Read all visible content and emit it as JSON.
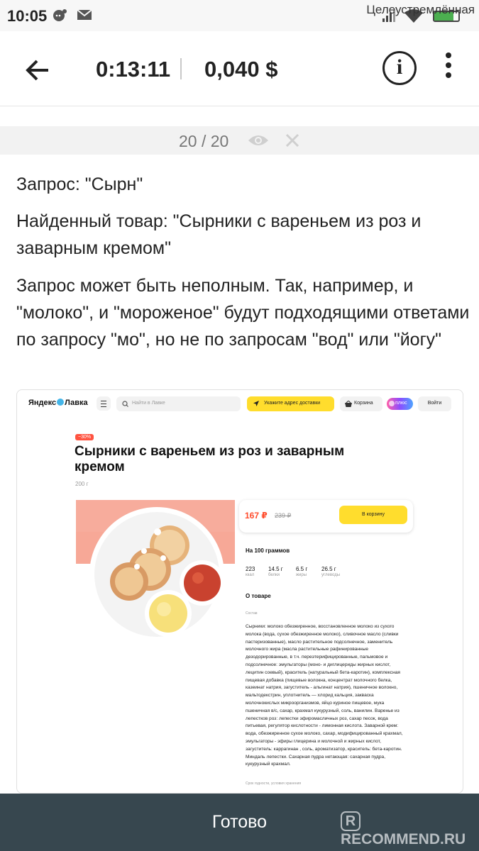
{
  "status_bar": {
    "time": "10:05",
    "carrier": "Целеустремлённая",
    "battery_level": 0.8
  },
  "header": {
    "timer": "0:13:11",
    "price": "0,040 $"
  },
  "strip": {
    "counter": "20 / 20"
  },
  "content": {
    "query": "Запрос: \"Сырн\"",
    "found": "Найденный товар: \"Сырники с вареньем из роз и заварным кремом\"",
    "note": "Запрос может быть неполным. Так, например, и \"молоко\", и \"мороженое\" будут подходящими ответами по запросу \"мо\", но не по запросам \"вод\" или \"йогу\""
  },
  "screenshot": {
    "logo_left": "Яндекс",
    "logo_right": "Лавка",
    "search_placeholder": "Найти в Лавке",
    "delivery_button": "Укажите адрес доставки",
    "cart_button": "Корзина",
    "plus_badge": "плюс",
    "login_button": "Войти",
    "discount_badge": "−30%",
    "product_title": "Сырники с вареньем из роз и заварным кремом",
    "weight": "200 г",
    "new_price": "167 ₽",
    "old_price": "239 ₽",
    "add_to_cart": "В корзину",
    "per_100_title": "На 100 граммов",
    "nutrition": [
      {
        "value": "223",
        "label": "ккал"
      },
      {
        "value": "14.5 г",
        "label": "белки"
      },
      {
        "value": "6.5 г",
        "label": "жиры"
      },
      {
        "value": "26.5 г",
        "label": "углеводы"
      }
    ],
    "about_title": "О товаре",
    "composition_label": "Состав",
    "composition": "Сырники: молоко обезжиренное, восстановленное молоко из сухого молока (вода, сухое обезжиренное молоко), сливочное масло (сливки пастеризованные), масло растительное подсолнечное, заменитель молочного жира (масла растительные рафинированные дезодорированные, в т.ч. переэтерифицированные, пальмовое и подсолнечное: эмульгаторы (моно- и диглицериды жирных кислот, лецитин соевый), краситель (натуральный бета-каротин), комплексная пищевая добавка (пищевые волокна, концентрат молочного белка, казеинат натрия, загуститель - альгинат натрия), пшеничное волокно, мальтодекстрин, уплотнитель — хлорид кальция, закваска молочнокислых микроорганизмов, яйцо куриное пищевое, мука пшеничная в/с, сахар, крахмал кукурузный, соль, ванилин. Варенье из лепестков роз: лепестки эфиромасличных роз, сахар песок, вода питьевая, регулятор кислотности - лимонная кислота. Заварной крем: вода, обезжиренное сухое молоко, сахар, модифицированный крахмал, эмульгаторы - эфиры глицерина и молочной и жирных кислот, загуститель: каррагинан , соль, ароматизатор, краситель: бета-каротин. Миндаль лепестки. Сахарная пудра нетающая: сахарная пудра, кукурузный крахмал.",
    "shelf_life": "Срок годности, условия хранения"
  },
  "bottom": {
    "done_label": "Готово",
    "watermark": "RECOMMEND.RU"
  },
  "colors": {
    "bottom_bar": "#37474f",
    "accent_yellow": "#ffdd2d",
    "price_red": "#ff4c2c",
    "photo_bg": "#f7a897"
  },
  "icons": {
    "back": "arrow-left-icon",
    "info": "info-icon",
    "menu": "more-vertical-icon",
    "eye": "eye-icon",
    "close": "close-icon"
  }
}
